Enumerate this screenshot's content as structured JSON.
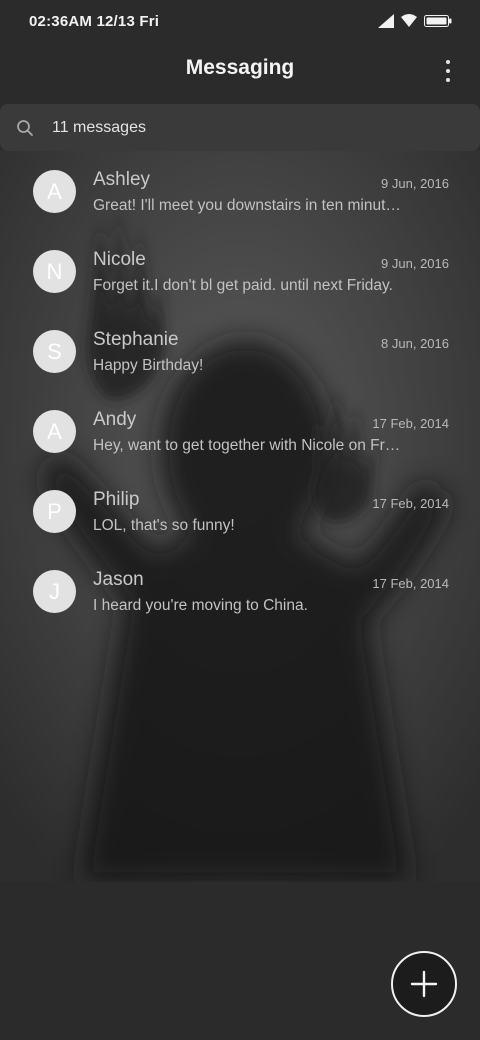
{
  "status_bar": {
    "time": "02:36AM 12/13 Fri",
    "icons": [
      "signal-icon",
      "wifi-icon",
      "battery-icon"
    ]
  },
  "app_bar": {
    "title": "Messaging",
    "menu_icon": "more-vert-icon"
  },
  "search": {
    "icon": "search-icon",
    "label": "11 messages"
  },
  "conversations": [
    {
      "initial": "A",
      "name": "Ashley",
      "date": "9 Jun, 2016",
      "preview": "Great! I'll meet you downstairs in ten minutes."
    },
    {
      "initial": "N",
      "name": "Nicole",
      "date": "9 Jun, 2016",
      "preview": "Forget it.I don't bl get paid. until next Friday."
    },
    {
      "initial": "S",
      "name": "Stephanie",
      "date": "8 Jun, 2016",
      "preview": "Happy Birthday!"
    },
    {
      "initial": "A",
      "name": "Andy",
      "date": "17 Feb, 2014",
      "preview": "Hey, want to get together with Nicole on Friday?"
    },
    {
      "initial": "P",
      "name": "Philip",
      "date": "17 Feb, 2014",
      "preview": "LOL, that's so funny!"
    },
    {
      "initial": "J",
      "name": "Jason",
      "date": "17 Feb, 2014",
      "preview": "I heard you're moving to China."
    }
  ],
  "fab": {
    "icon": "plus-icon"
  },
  "colors": {
    "background": "#2b2b2b",
    "search_bg": "#3a3a3a",
    "avatar_bg": "#e2e2e2"
  }
}
